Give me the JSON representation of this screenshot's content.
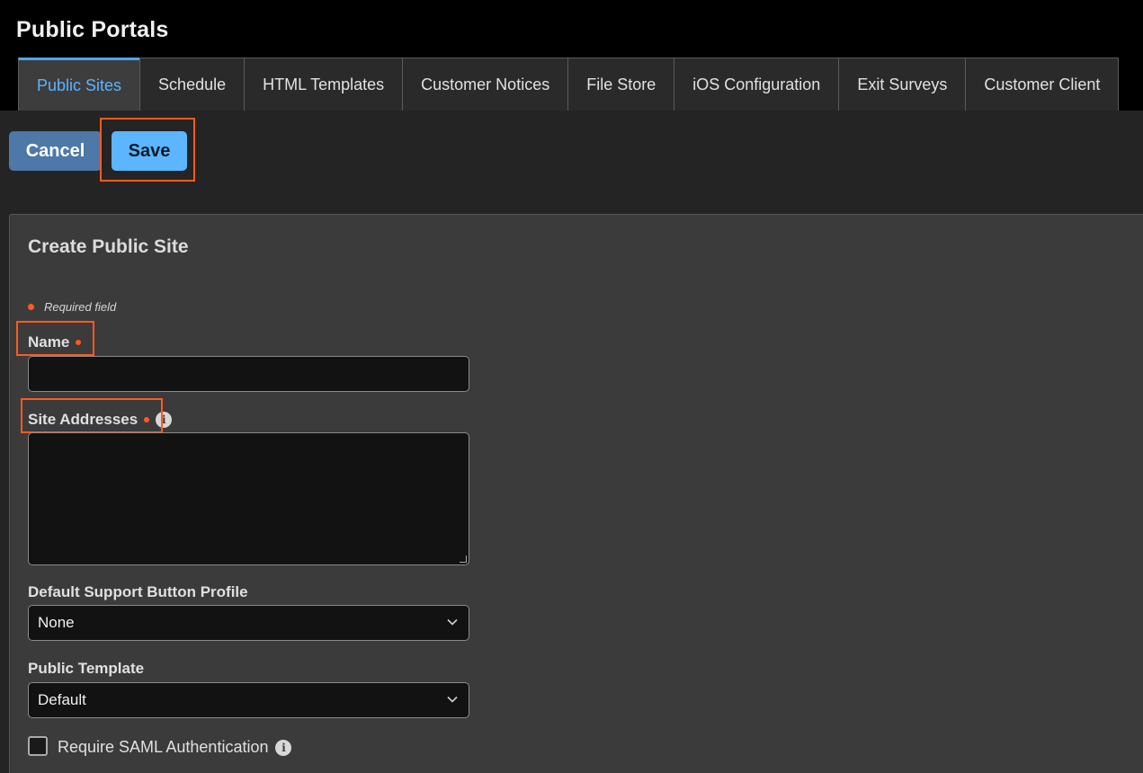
{
  "header": {
    "title": "Public Portals"
  },
  "tabs": [
    {
      "label": "Public Sites"
    },
    {
      "label": "Schedule"
    },
    {
      "label": "HTML Templates"
    },
    {
      "label": "Customer Notices"
    },
    {
      "label": "File Store"
    },
    {
      "label": "iOS Configuration"
    },
    {
      "label": "Exit Surveys"
    },
    {
      "label": "Customer Client"
    }
  ],
  "toolbar": {
    "cancel_label": "Cancel",
    "save_label": "Save"
  },
  "form": {
    "title": "Create Public Site",
    "required_note": "Required field",
    "name_label": "Name",
    "name_value": "",
    "site_addresses_label": "Site Addresses",
    "site_addresses_value": "",
    "support_profile_label": "Default Support Button Profile",
    "support_profile_value": "None",
    "public_template_label": "Public Template",
    "public_template_value": "Default",
    "saml_label": "Require SAML Authentication"
  },
  "colors": {
    "accent": "#5cb6ff",
    "active_tab_text": "#5cb3ff",
    "cancel_button": "#4d78a8",
    "required_marker": "#ff5a1f",
    "highlight": "#ff5a1f"
  },
  "icons": [
    "info-icon",
    "chevron-down-icon",
    "required-dot-icon"
  ]
}
